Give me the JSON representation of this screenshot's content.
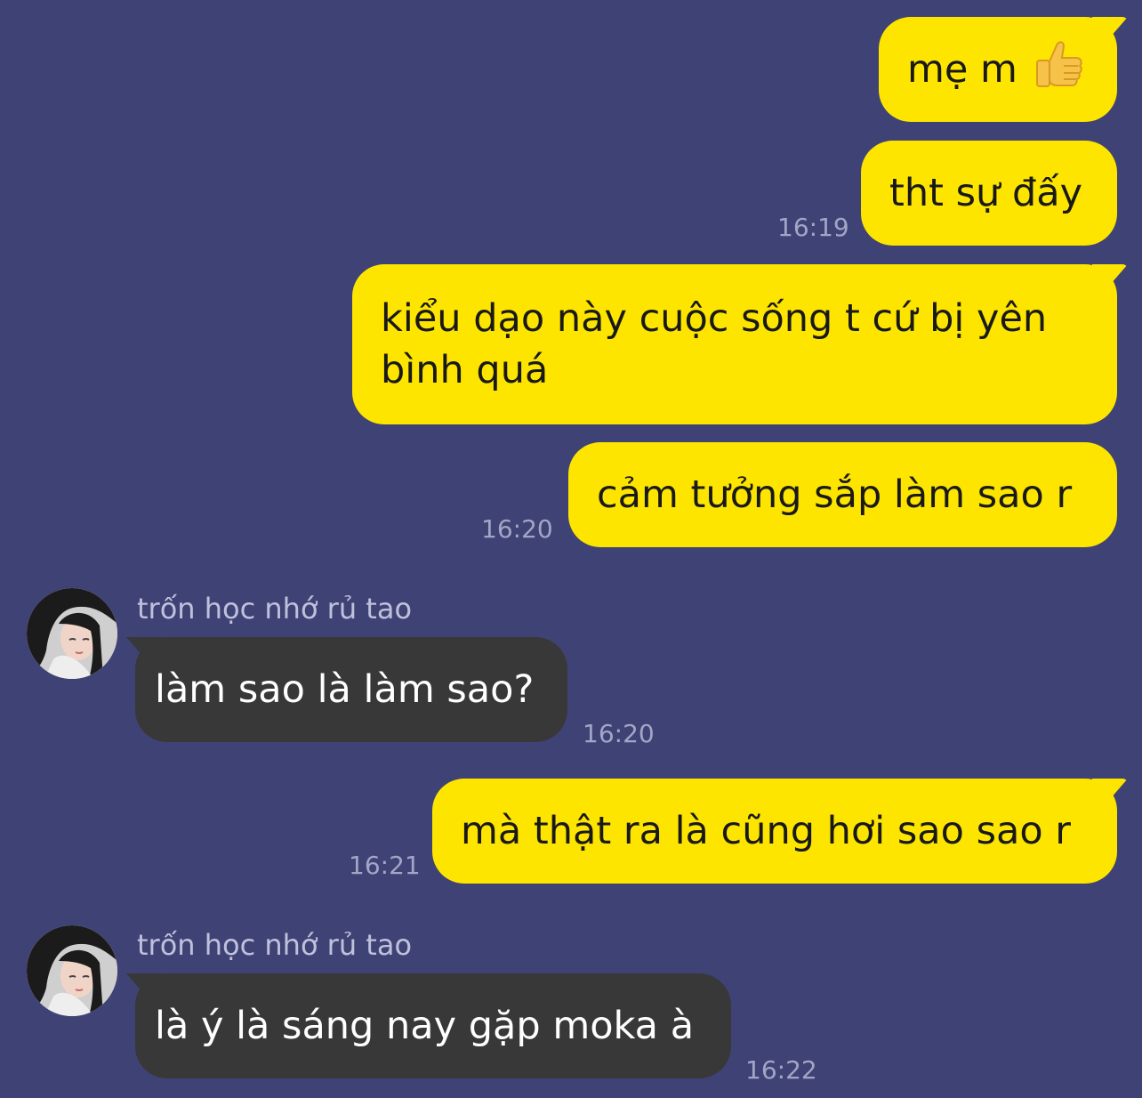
{
  "colors": {
    "background": "#3f4274",
    "outgoing_bubble": "#fee500",
    "incoming_bubble": "#383838",
    "timestamp": "#a3a5c6"
  },
  "messages": [
    {
      "direction": "out",
      "text": "mẹ m",
      "icon": "thumbs-up-icon"
    },
    {
      "direction": "out",
      "text": "tht sự đấy",
      "time": "16:19"
    },
    {
      "direction": "out",
      "text": "kiểu dạo này cuộc sống t cứ bị yên bình quá"
    },
    {
      "direction": "out",
      "text": "cảm tưởng sắp làm sao r",
      "time": "16:20"
    },
    {
      "direction": "in",
      "sender": "trốn học nhớ rủ tao",
      "text": "làm sao là làm sao?",
      "time": "16:20"
    },
    {
      "direction": "out",
      "text": "mà thật ra là cũng hơi sao sao r",
      "time": "16:21"
    },
    {
      "direction": "in",
      "sender": "trốn học nhớ rủ tao",
      "text": "là ý là sáng nay gặp moka à",
      "time": "16:22"
    }
  ]
}
